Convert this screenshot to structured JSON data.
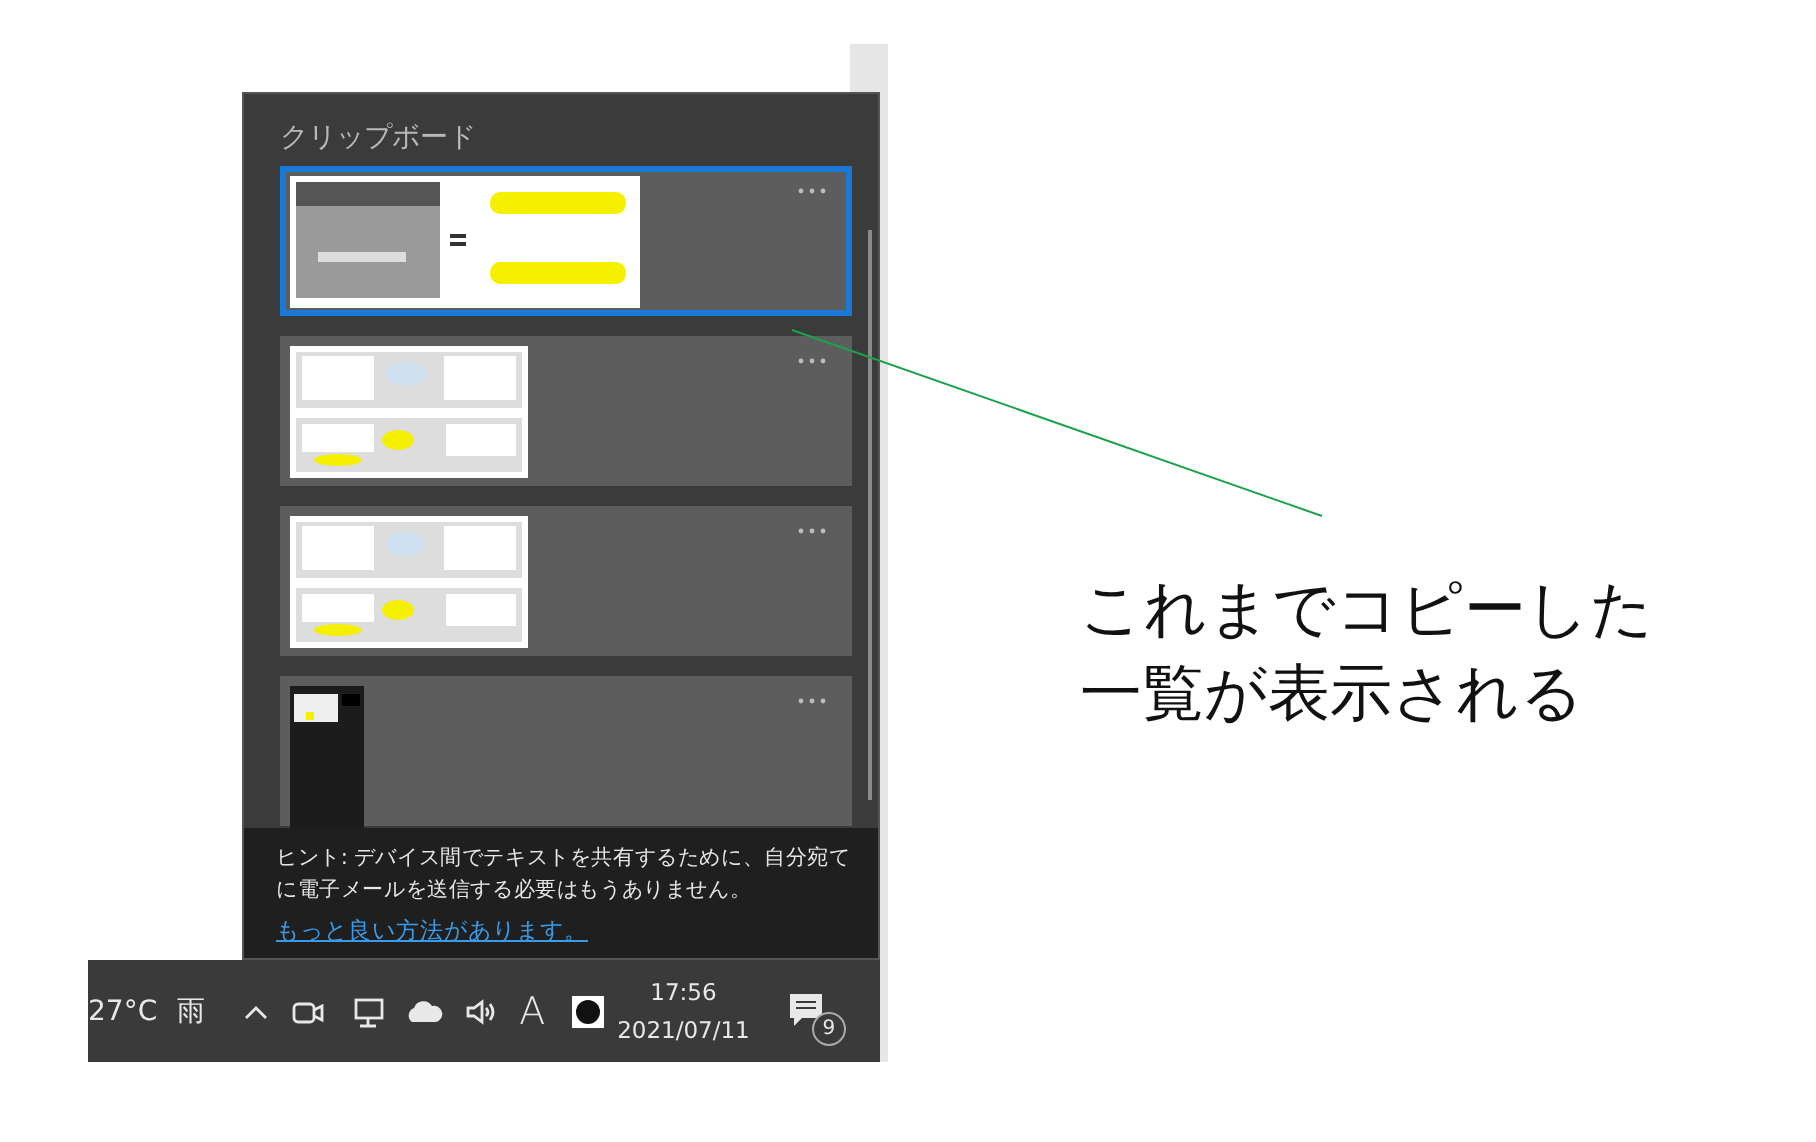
{
  "panel": {
    "title": "クリップボード",
    "items": [
      {
        "kind": "ribbon",
        "selected": true
      },
      {
        "kind": "flow",
        "selected": false
      },
      {
        "kind": "flow",
        "selected": false
      },
      {
        "kind": "phone",
        "selected": false
      }
    ],
    "hint": {
      "text": "ヒント: デバイス間でテキストを共有するために、自分宛てに電子メールを送信する必要はもうありません。",
      "link": "もっと良い方法があります。"
    }
  },
  "taskbar": {
    "temperature": "27°C",
    "weather": "雨",
    "ime": "A",
    "time": "17:56",
    "date": "2021/07/11",
    "notifications": "9"
  },
  "annotation": {
    "lines": [
      "これまでコピーした",
      "一覧が表示される"
    ]
  }
}
